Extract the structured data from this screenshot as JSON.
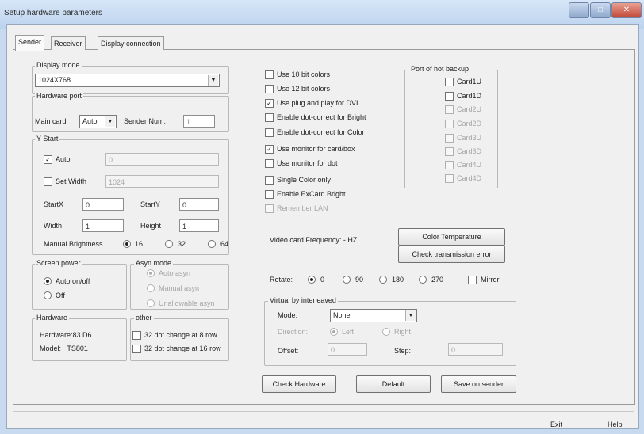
{
  "window": {
    "title": "Setup hardware parameters",
    "controls": [
      "–",
      "□",
      "✕"
    ]
  },
  "tabs": [
    {
      "label": "Sender"
    },
    {
      "label": "Receiver"
    },
    {
      "label": "Display connection"
    }
  ],
  "display_mode": {
    "label": "Display mode",
    "value": "1024X768"
  },
  "hardware_port": {
    "label": "Hardware port",
    "main_card_label": "Main card",
    "main_card_value": "Auto",
    "sender_num_label": "Sender Num:",
    "sender_num_value": "1"
  },
  "y_start": {
    "label": "Y Start",
    "auto_label": "Auto",
    "auto_checked": true,
    "auto_value": "0",
    "set_width_label": "Set Width",
    "set_width_value": "1024",
    "startx_label": "StartX",
    "startx_value": "0",
    "starty_label": "StartY",
    "starty_value": "0",
    "width_label": "Width",
    "width_value": "1",
    "height_label": "Height",
    "height_value": "1",
    "manual_brightness_label": "Manual Brightness",
    "brightness_options": [
      "16",
      "32",
      "64"
    ],
    "brightness_selected": "16"
  },
  "screen_power": {
    "label": "Screen power",
    "options": [
      "Auto on/off",
      "Off"
    ],
    "selected": "Auto on/off"
  },
  "async_mode": {
    "label": "Asyn mode",
    "options": [
      "Auto asyn",
      "Manual asyn",
      "Unallowable asyn"
    ],
    "selected": "Auto asyn"
  },
  "hardware": {
    "label": "Hardware",
    "hardware_line": "Hardware:83.D6",
    "model_line": "Model:   TS801"
  },
  "other": {
    "label": "other",
    "items": [
      "32 dot change at 8 row",
      "32 dot change at 16 row"
    ]
  },
  "options": [
    {
      "label": "Use 10 bit colors",
      "checked": false,
      "disabled": false
    },
    {
      "label": "Use 12 bit colors",
      "checked": false,
      "disabled": false
    },
    {
      "label": "Use plug and play for DVI",
      "checked": true,
      "disabled": false
    },
    {
      "label": "Enable dot-correct for Bright",
      "checked": false,
      "disabled": false
    },
    {
      "label": "Enable dot-correct for Color",
      "checked": false,
      "disabled": false
    },
    {
      "label": "Use monitor for card/box",
      "checked": true,
      "disabled": false
    },
    {
      "label": "Use monitor for dot",
      "checked": false,
      "disabled": false
    },
    {
      "label": "Single Color only",
      "checked": false,
      "disabled": false
    },
    {
      "label": "Enable ExCard Bright",
      "checked": false,
      "disabled": false
    },
    {
      "label": "Remember LAN",
      "checked": false,
      "disabled": true
    }
  ],
  "hot_backup": {
    "label": "Port of hot backup",
    "cards": [
      {
        "label": "Card1U",
        "disabled": false
      },
      {
        "label": "Card1D",
        "disabled": false
      },
      {
        "label": "Card2U",
        "disabled": true
      },
      {
        "label": "Card2D",
        "disabled": true
      },
      {
        "label": "Card3U",
        "disabled": true
      },
      {
        "label": "Card3D",
        "disabled": true
      },
      {
        "label": "Card4U",
        "disabled": true
      },
      {
        "label": "Card4D",
        "disabled": true
      }
    ]
  },
  "video_freq": "Video card Frequency: - HZ",
  "buttons": {
    "color_temp": "Color Temperature",
    "check_tx": "Check transmission error",
    "check_hw": "Check Hardware",
    "default": "Default",
    "save": "Save on sender",
    "exit": "Exit",
    "help": "Help"
  },
  "rotate": {
    "label": "Rotate:",
    "options": [
      "0",
      "90",
      "180",
      "270"
    ],
    "selected": "0",
    "mirror_label": "Mirror"
  },
  "virtual": {
    "label": "Virtual by interleaved",
    "mode_label": "Mode:",
    "mode_value": "None",
    "direction_label": "Direction:",
    "direction_options": [
      "Left",
      "Right"
    ],
    "offset_label": "Offset:",
    "offset_value": "0",
    "step_label": "Step:",
    "step_value": "0"
  }
}
